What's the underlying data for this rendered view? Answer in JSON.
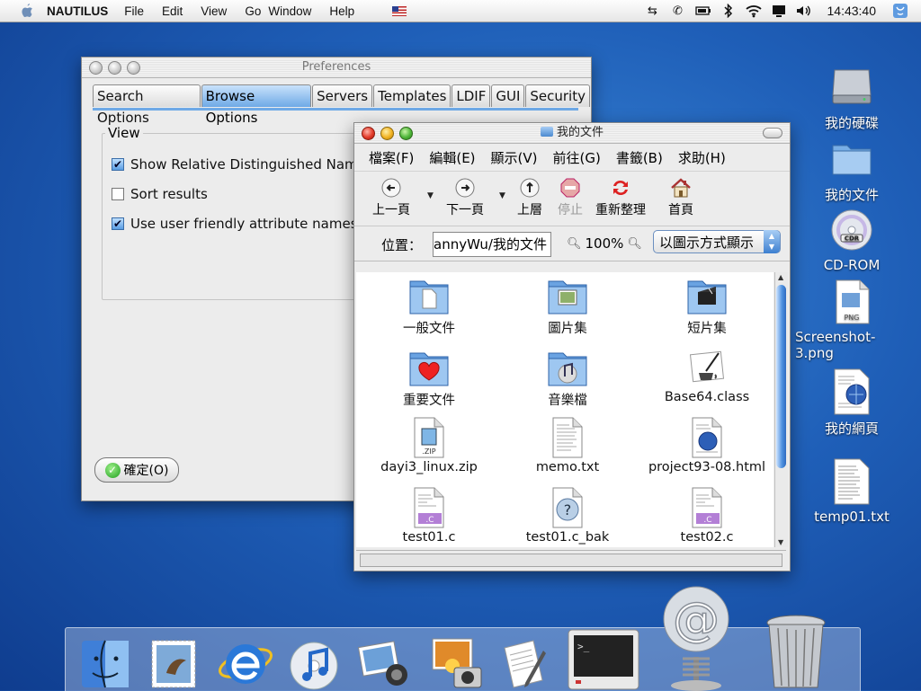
{
  "menubar": {
    "app_name": "NAUTILUS",
    "items": [
      "File",
      "Edit",
      "View",
      "Go",
      "Window",
      "Help"
    ],
    "clock": "14:43:40"
  },
  "preferences": {
    "title": "Preferences",
    "tabs": [
      "Search Options",
      "Browse Options",
      "Servers",
      "Templates",
      "LDIF",
      "GUI",
      "Security"
    ],
    "active_tab": "Browse Options",
    "group_label": "View",
    "options": [
      {
        "label": "Show Relative Distinguished Name",
        "checked": true
      },
      {
        "label": "Sort results",
        "checked": false
      },
      {
        "label": "Use user friendly attribute names",
        "checked": true
      }
    ],
    "ok_label": "確定(O)"
  },
  "file_window": {
    "title": "我的文件",
    "menu": [
      "檔案(F)",
      "編輯(E)",
      "顯示(V)",
      "前往(G)",
      "書籤(B)",
      "求助(H)"
    ],
    "toolbar": {
      "back": "上一頁",
      "forward": "下一頁",
      "up": "上層",
      "stop": "停止",
      "reload": "重新整理",
      "home": "首頁"
    },
    "location_label": "位置：",
    "location_value": "annyWu/我的文件",
    "zoom": "100%",
    "view_mode": "以圖示方式顯示",
    "files": [
      {
        "name": "一般文件",
        "kind": "folder-doc"
      },
      {
        "name": "圖片集",
        "kind": "folder-pic"
      },
      {
        "name": "短片集",
        "kind": "folder-movie"
      },
      {
        "name": "重要文件",
        "kind": "folder-heart"
      },
      {
        "name": "音樂檔",
        "kind": "folder-music"
      },
      {
        "name": "Base64.class",
        "kind": "java"
      },
      {
        "name": "dayi3_linux.zip",
        "kind": "zip"
      },
      {
        "name": "memo.txt",
        "kind": "text"
      },
      {
        "name": "project93-08.html",
        "kind": "html"
      },
      {
        "name": "test01.c",
        "kind": "c"
      },
      {
        "name": "test01.c_bak",
        "kind": "unknown"
      },
      {
        "name": "test02.c",
        "kind": "c"
      }
    ]
  },
  "desktop": [
    {
      "name": "我的硬碟",
      "kind": "harddisk"
    },
    {
      "name": "我的文件",
      "kind": "folder"
    },
    {
      "name": "CD-ROM",
      "kind": "cdrom"
    },
    {
      "name": "Screenshot-3.png",
      "kind": "png"
    },
    {
      "name": "我的網頁",
      "kind": "webpage"
    },
    {
      "name": "temp01.txt",
      "kind": "text"
    }
  ],
  "dock": [
    "finder",
    "mail",
    "internet-explorer",
    "itunes",
    "iphoto",
    "image-capture",
    "textedit",
    "terminal",
    "mail-at",
    "trash"
  ],
  "png_badge": "PNG",
  "cd_badge": "CDR",
  "file_badges": {
    "zip": ".ZIP",
    "c": ".C"
  }
}
